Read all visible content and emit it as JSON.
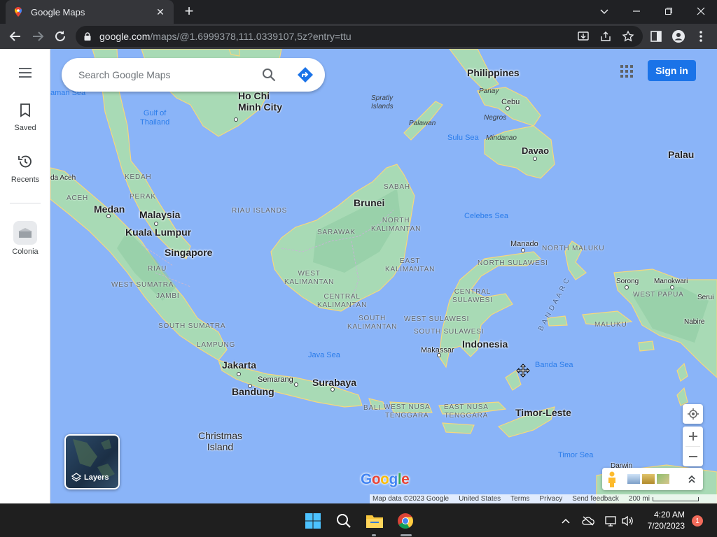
{
  "browser": {
    "tab_title": "Google Maps",
    "url_host": "google.com",
    "url_path": "/maps/@1.6999378,111.0339107,5z?entry=ttu"
  },
  "sidebar": {
    "saved_label": "Saved",
    "recents_label": "Recents",
    "colonia_label": "Colonia"
  },
  "search": {
    "placeholder": "Search Google Maps"
  },
  "header": {
    "signin_label": "Sign in"
  },
  "map": {
    "labels": {
      "philippines": "Philippines",
      "palau": "Palau",
      "brunei": "Brunei",
      "malaysia": "Malaysia",
      "singapore": "Singapore",
      "indonesia": "Indonesia",
      "timor_leste": "Timor-Leste",
      "ho_chi_minh": "Ho Chi\nMinh City",
      "medan": "Medan",
      "kuala_lumpur": "Kuala Lumpur",
      "jakarta": "Jakarta",
      "bandung": "Bandung",
      "surabaya": "Surabaya",
      "semarang": "Semarang",
      "makassar": "Makassar",
      "manado": "Manado",
      "davao": "Davao",
      "cebu": "Cebu",
      "panay": "Panay",
      "negros": "Negros",
      "mindanao": "Mindanao",
      "palawan": "Palawan",
      "spratly": "Spratly\nIslands",
      "sorong": "Sorong",
      "nabire": "Nabire",
      "darwin": "Darwin",
      "christmas_island": "Christmas\nIsland",
      "banda_aceh": "da Aceh",
      "aceh": "ACEH",
      "kedah": "KEDAH",
      "perak": "PERAK",
      "riau_islands": "RIAU ISLANDS",
      "riau": "RIAU",
      "west_sumatra": "WEST SUMATRA",
      "jambi": "JAMBI",
      "south_sumatra": "SOUTH SUMATRA",
      "lampung": "LAMPUNG",
      "sabah": "SABAH",
      "sarawak": "SARAWAK",
      "north_kalimantan": "NORTH\nKALIMANTAN",
      "east_kalimantan": "EAST\nKALIMANTAN",
      "west_kalimantan": "WEST\nKALIMANTAN",
      "central_kalimantan": "CENTRAL\nKALIMANTAN",
      "south_kalimantan": "SOUTH\nKALIMANTAN",
      "north_maluku": "NORTH MALUKU",
      "north_sulawesi": "NORTH SULAWESI",
      "central_sulawesi": "CENTRAL\nSULAWESI",
      "west_sulawesi": "WEST SULAWESI",
      "south_sulawesi": "SOUTH SULAWESI",
      "maluku": "MALUKU",
      "west_papua": "WEST PAPUA",
      "bali": "BALI",
      "west_nusa_tenggara": "WEST NUSA\nTENGGARA",
      "east_nusa_tenggara": "EAST NUSA\nTENGGARA",
      "gulf_of_thailand": "Gulf of\nThailand",
      "sulu_sea": "Sulu Sea",
      "celebes_sea": "Celebes Sea",
      "java_sea": "Java Sea",
      "banda_sea": "Banda Sea",
      "timor_sea": "Timor Sea",
      "andaman_sea": "aman Sea",
      "banda_arc": "B A N D A   A R C",
      "serui": "Serui",
      "manokwari": "Manokwari"
    },
    "layers_label": "Layers",
    "google_logo": "Google",
    "scale_label": "200 mi"
  },
  "footer": {
    "map_data": "Map data ©2023 Google",
    "country": "United States",
    "terms": "Terms",
    "privacy": "Privacy",
    "feedback": "Send feedback"
  },
  "taskbar": {
    "time": "4:20 AM",
    "date": "7/20/2023",
    "notifications": "1"
  },
  "colors": {
    "water": "#8ab4f8",
    "land": "#a8dab5",
    "brand_blue": "#1a73e8"
  }
}
